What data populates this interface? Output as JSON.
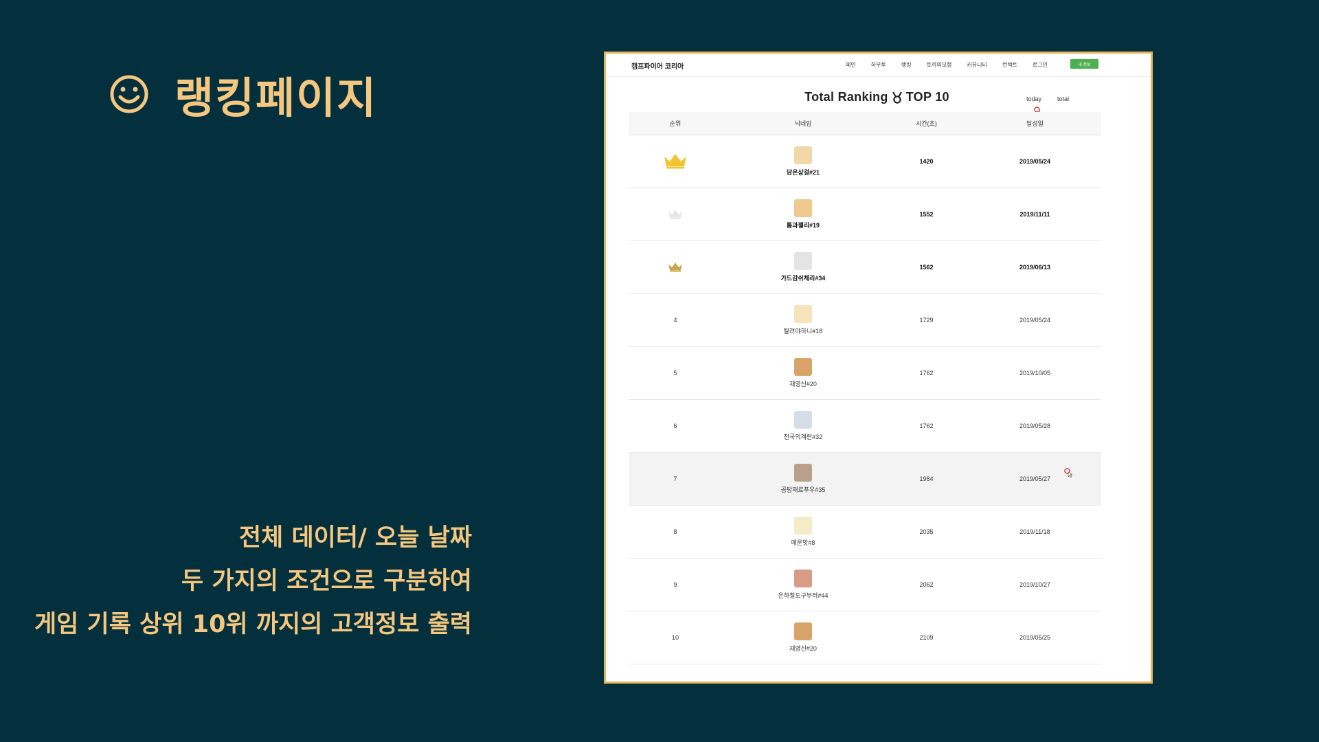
{
  "slide": {
    "title": "랭킹페이지",
    "desc_lines": [
      "전체 데이터/ 오늘 날짜",
      "두 가지의 조건으로 구분하여",
      "게임 기록 상위 10위 까지의 고객정보 출력"
    ],
    "accent_color": "#f6c77e",
    "background_color": "#04303d"
  },
  "screenshot": {
    "brand": "캠프파이어 코리아",
    "nav_links": [
      "메인",
      "하우투",
      "랭킹",
      "토끼의모험",
      "커뮤니티",
      "컨택트",
      "로그인"
    ],
    "nav_button": "내 정보",
    "title_left": "Total Ranking",
    "title_right": "TOP 10",
    "title_icon": "medal-icon",
    "filters": [
      "today",
      "total"
    ],
    "headers": [
      "순위",
      "닉네임",
      "시간(초)",
      "달성일"
    ],
    "rows": [
      {
        "rank": "",
        "rank_icon": "crown-gold-icon",
        "nickname": "담은상걸#21",
        "time": "1420",
        "date": "2019/05/24",
        "avatar_color": "#f1d8a6"
      },
      {
        "rank": "",
        "rank_icon": "crown-silver-icon",
        "nickname": "톰과젤리#19",
        "time": "1552",
        "date": "2019/11/11",
        "avatar_color": "#f0c98e"
      },
      {
        "rank": "",
        "rank_icon": "crown-bronze-icon",
        "nickname": "가드감쉬체리#34",
        "time": "1562",
        "date": "2019/06/13",
        "avatar_color": "#e4e4e4"
      },
      {
        "rank": "4",
        "nickname": "탈려야하니#18",
        "time": "1729",
        "date": "2019/05/24",
        "avatar_color": "#f6e2bc"
      },
      {
        "rank": "5",
        "nickname": "재영신#20",
        "time": "1762",
        "date": "2019/10/05",
        "avatar_color": "#d9a36a"
      },
      {
        "rank": "6",
        "nickname": "천국의계란#32",
        "time": "1762",
        "date": "2019/05/28",
        "avatar_color": "#d5dee6"
      },
      {
        "rank": "7",
        "nickname": "곰탕재료푸우#35",
        "time": "1984",
        "date": "2019/05/27",
        "avatar_color": "#b9a08a"
      },
      {
        "rank": "8",
        "nickname": "매운맛#8",
        "time": "2035",
        "date": "2019/11/18",
        "avatar_color": "#f3ecc6"
      },
      {
        "rank": "9",
        "nickname": "은하철도구부러#44",
        "time": "2062",
        "date": "2019/10/27",
        "avatar_color": "#d99a86"
      },
      {
        "rank": "10",
        "nickname": "재영신#20",
        "time": "2109",
        "date": "2019/05/25",
        "avatar_color": "#d9a36a"
      }
    ]
  }
}
